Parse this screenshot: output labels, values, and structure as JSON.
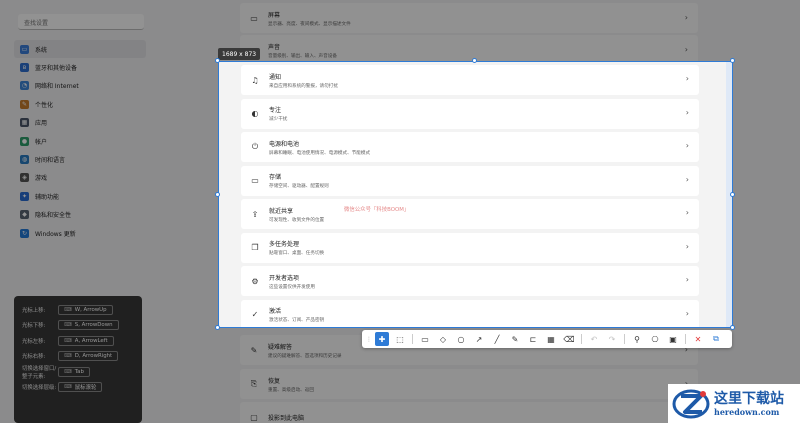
{
  "search": {
    "placeholder": "查找设置"
  },
  "nav": [
    {
      "label": "系统",
      "icon": "monitor-icon",
      "color": "#3b7dd8",
      "active": true
    },
    {
      "label": "蓝牙和其他设备",
      "icon": "bluetooth-icon",
      "color": "#2f6fcf"
    },
    {
      "label": "网络和 Internet",
      "icon": "wifi-icon",
      "color": "#3d86d6"
    },
    {
      "label": "个性化",
      "icon": "brush-icon",
      "color": "#c47a2e"
    },
    {
      "label": "应用",
      "icon": "apps-icon",
      "color": "#4a5568"
    },
    {
      "label": "帐户",
      "icon": "account-icon",
      "color": "#2f9e6a"
    },
    {
      "label": "时间和语言",
      "icon": "globe-icon",
      "color": "#2a7bc0"
    },
    {
      "label": "游戏",
      "icon": "gamepad-icon",
      "color": "#555"
    },
    {
      "label": "辅助功能",
      "icon": "accessibility-icon",
      "color": "#2a6bd1"
    },
    {
      "label": "隐私和安全性",
      "icon": "shield-icon",
      "color": "#5a6472"
    },
    {
      "label": "Windows 更新",
      "icon": "update-icon",
      "color": "#2479d6"
    }
  ],
  "background_rows": [
    {
      "title": "屏幕",
      "subtitle": "显示器、亮度、夜间模式、显示描述文件",
      "icon": "display-icon"
    },
    {
      "title": "声音",
      "subtitle": "音量级别、输出、输入、声音设备",
      "icon": "speaker-icon"
    },
    {
      "title": "疑难解答",
      "subtitle": "建议的疑难解答、首选项和历史记录",
      "icon": "wrench-icon"
    },
    {
      "title": "恢复",
      "subtitle": "重置、高级启动、返回",
      "icon": "recovery-icon"
    },
    {
      "title": "投影到此电脑",
      "subtitle": "",
      "icon": "project-icon"
    }
  ],
  "selection": {
    "size_label": "1689 x 873",
    "watermark": "微信公众号「科技BOOM」",
    "rows": [
      {
        "title": "通知",
        "subtitle": "来自应用和系统的警报，请勿打扰",
        "icon": "bell-icon"
      },
      {
        "title": "专注",
        "subtitle": "减少干扰",
        "icon": "focus-icon"
      },
      {
        "title": "电源和电池",
        "subtitle": "屏幕和睡眠、电池使用情况、电源模式、节能模式",
        "icon": "power-icon"
      },
      {
        "title": "存储",
        "subtitle": "存储空间、驱动器、配置规则",
        "icon": "storage-icon"
      },
      {
        "title": "就近共享",
        "subtitle": "可发现性、收到文件的位置",
        "icon": "share-icon"
      },
      {
        "title": "多任务处理",
        "subtitle": "贴靠窗口、桌面、任务切换",
        "icon": "multitask-icon"
      },
      {
        "title": "开发者选项",
        "subtitle": "这些设置仅供开发使用",
        "icon": "developer-icon"
      },
      {
        "title": "激活",
        "subtitle": "激活状态、订阅、产品密钥",
        "icon": "activation-icon"
      }
    ]
  },
  "hints": [
    {
      "label": "光标上移:",
      "key": "W, ArrowUp"
    },
    {
      "label": "光标下移:",
      "key": "S, ArrowDown"
    },
    {
      "label": "光标左移:",
      "key": "A, ArrowLeft"
    },
    {
      "label": "光标右移:",
      "key": "D, ArrowRight"
    },
    {
      "label": "切换选择窗口/整子元素:",
      "key": "Tab"
    },
    {
      "label": "切换选择层级:",
      "key": "鼠标滚轮"
    }
  ],
  "logo": {
    "cn": "这里下载站",
    "en": "heredown.com"
  }
}
